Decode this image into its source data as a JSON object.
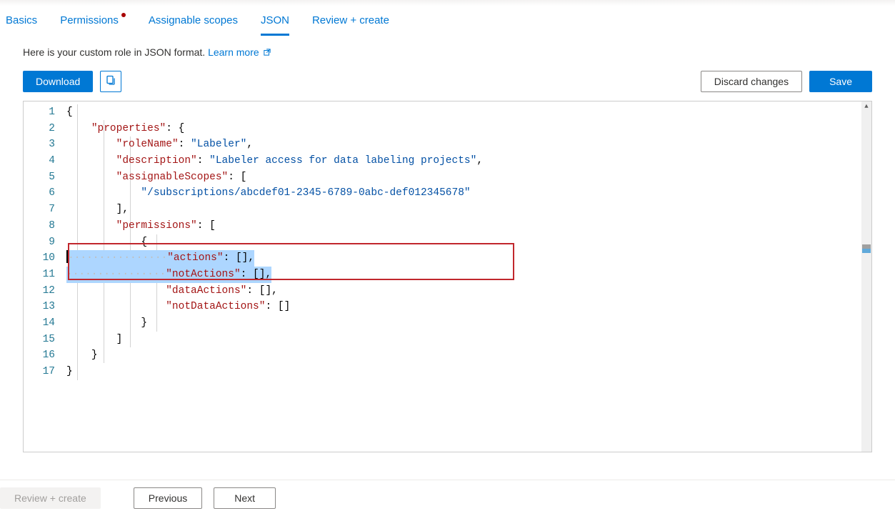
{
  "tabs": [
    {
      "label": "Basics",
      "active": false,
      "indicator": false
    },
    {
      "label": "Permissions",
      "active": false,
      "indicator": true
    },
    {
      "label": "Assignable scopes",
      "active": false,
      "indicator": false
    },
    {
      "label": "JSON",
      "active": true,
      "indicator": false
    },
    {
      "label": "Review + create",
      "active": false,
      "indicator": false
    }
  ],
  "description_text": "Here is your custom role in JSON format. ",
  "learn_more_label": "Learn more",
  "buttons": {
    "download": "Download",
    "discard": "Discard changes",
    "save": "Save",
    "review_create": "Review + create",
    "previous": "Previous",
    "next": "Next"
  },
  "code": {
    "line_numbers": [
      "1",
      "2",
      "3",
      "4",
      "5",
      "6",
      "7",
      "8",
      "9",
      "10",
      "11",
      "12",
      "13",
      "14",
      "15",
      "16",
      "17"
    ],
    "roleName_key": "\"roleName\"",
    "roleName_val": "\"Labeler\"",
    "description_key": "\"description\"",
    "description_val": "\"Labeler access for data labeling projects\"",
    "assignableScopes_key": "\"assignableScopes\"",
    "scope_val": "\"/subscriptions/abcdef01-2345-6789-0abc-def012345678\"",
    "permissions_key": "\"permissions\"",
    "properties_key": "\"properties\"",
    "actions_key": "\"actions\"",
    "notActions_key": "\"notActions\"",
    "dataActions_key": "\"dataActions\"",
    "notDataActions_key": "\"notDataActions\""
  }
}
